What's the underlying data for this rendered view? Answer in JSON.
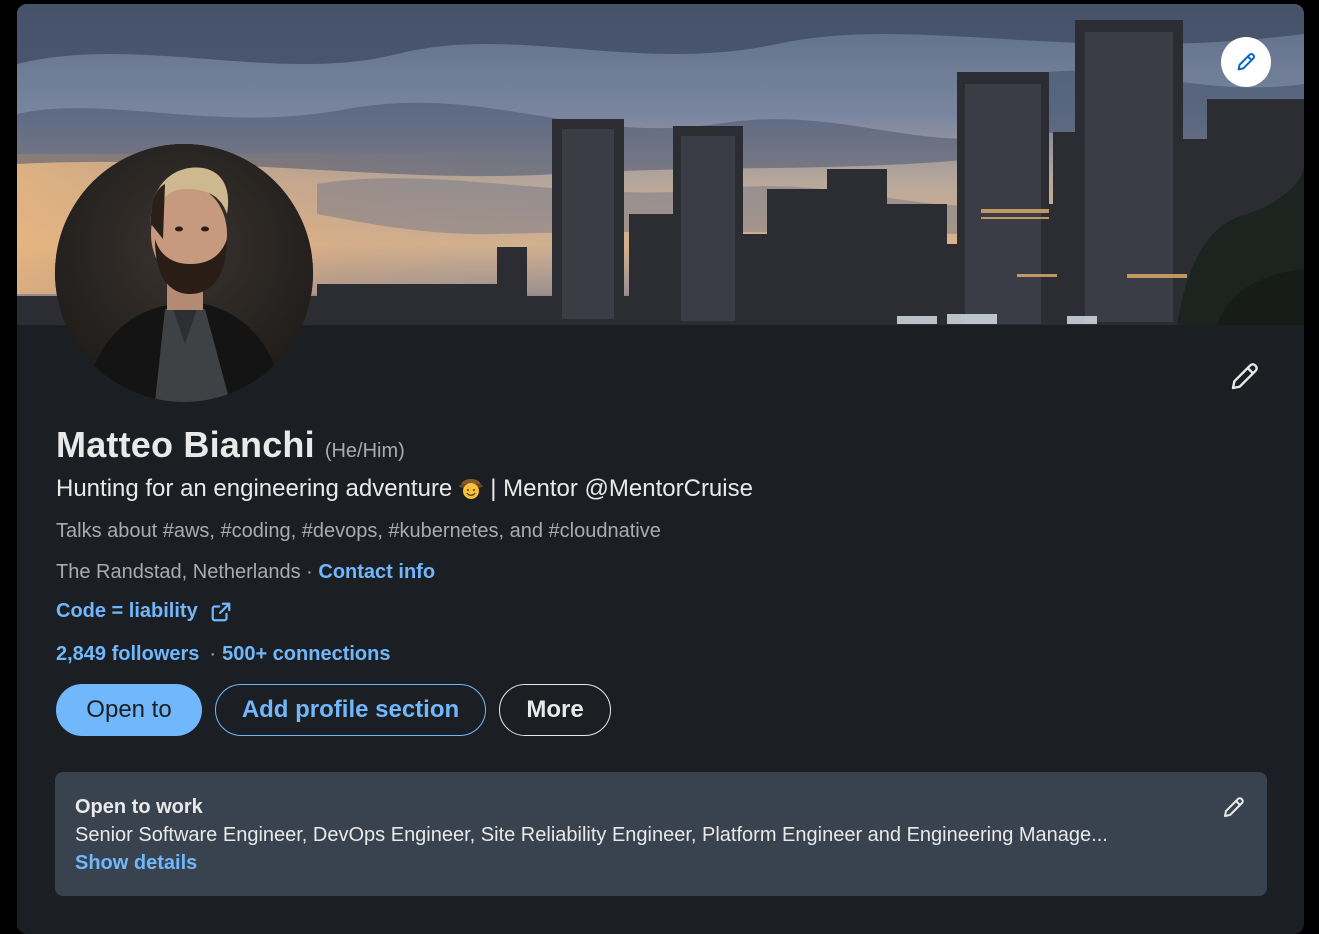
{
  "profile": {
    "name": "Matteo Bianchi",
    "pronouns": "(He/Him)",
    "headline_part1": "Hunting for an engineering adventure",
    "headline_emoji": "cowboy-hat-face-emoji",
    "headline_part2": "| Mentor @MentorCruise",
    "talks_about": "Talks about #aws, #coding, #devops, #kubernetes, and #cloudnative",
    "location": "The Randstad, Netherlands",
    "location_sep": "·",
    "contact_info": "Contact info",
    "website": "Code = liability",
    "followers": "2,849 followers",
    "network_sep": "·",
    "connections": "500+ connections"
  },
  "actions": {
    "open_to": "Open to",
    "add_section": "Add profile section",
    "more": "More"
  },
  "open_to_work": {
    "title": "Open to work",
    "roles": "Senior Software Engineer, DevOps Engineer, Site Reliability Engineer, Platform Engineer and Engineering Manage...",
    "show_details": "Show details"
  },
  "icons": {
    "banner_edit": "pencil-icon",
    "intro_edit": "pencil-icon",
    "open_to_work_edit": "pencil-icon",
    "external_link": "external-link-icon"
  },
  "colors": {
    "card_bg": "#1b1f23",
    "link": "#71b7fb",
    "primary_text": "#e9e9e9",
    "secondary_text": "#a9acaf",
    "open_to_work_bg": "#38434f"
  }
}
